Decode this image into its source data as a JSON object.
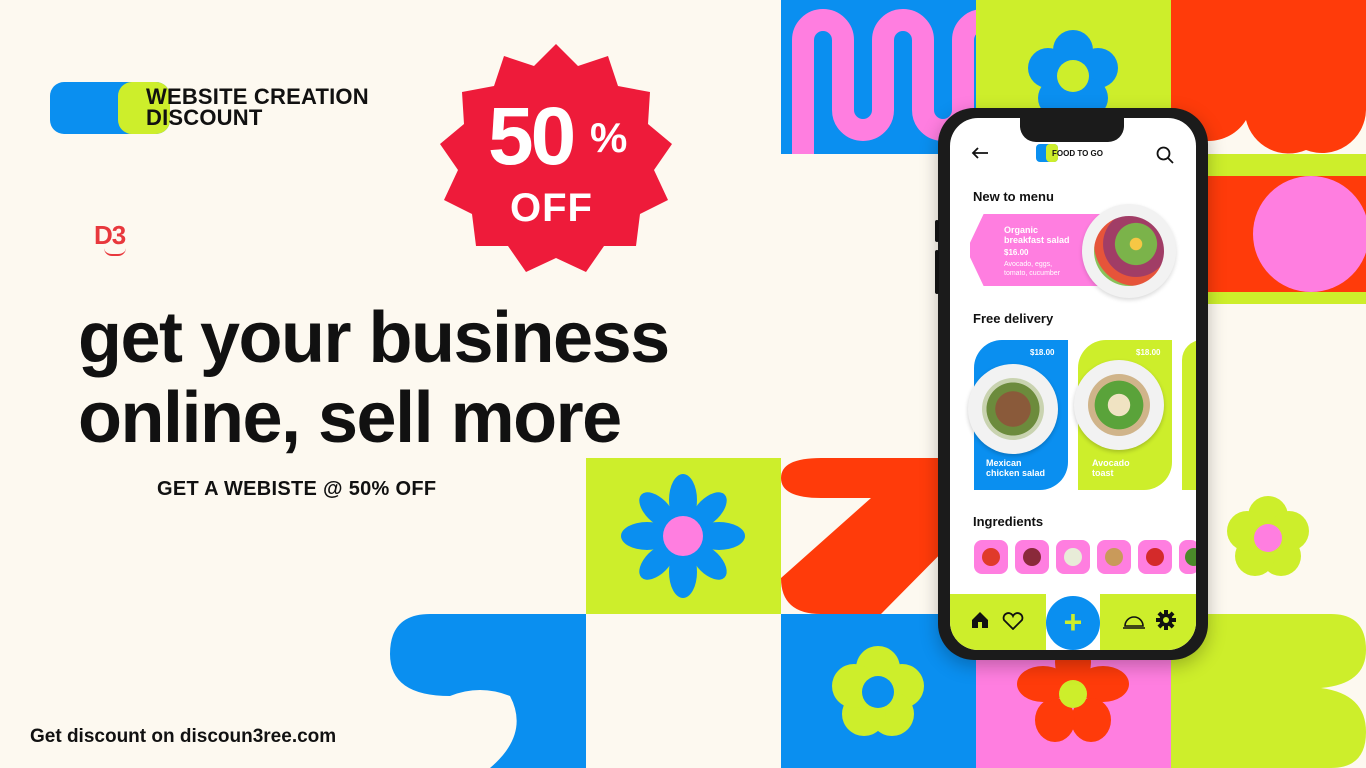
{
  "badge": {
    "text": "WEBSITE CREATION\nDISCOUNT"
  },
  "logo": {
    "text": "D3"
  },
  "headline": "get your business\nonline, sell more",
  "subhead": "GET A WEBISTE @ 50% OFF",
  "footer": "Get discount on discoun3ree.com",
  "burst": {
    "percent": "50",
    "sign": "%",
    "off": "OFF",
    "color": "#ee1b3a"
  },
  "colors": {
    "blue": "#0a8ff0",
    "lime": "#cdee2b",
    "pink": "#ff7ee0",
    "red": "#ff3b0a",
    "cream": "#fdf9f0"
  },
  "phone": {
    "back_icon": "arrow-left-icon",
    "brand": "FOOD TO GO",
    "search_icon": "search-icon",
    "new_to_menu": {
      "title": "New to menu",
      "item": {
        "name": "Organic\nbreakfast salad",
        "price": "$16.00",
        "desc": "Avocado, eggs,\ntomato, cucumber"
      }
    },
    "free_delivery": {
      "title": "Free delivery",
      "cards": [
        {
          "name": "Mexican\nchicken salad",
          "price": "$18.00"
        },
        {
          "name": "Avocado\ntoast",
          "price": "$18.00"
        }
      ]
    },
    "ingredients": {
      "title": "Ingredients",
      "items": [
        "tomato",
        "onion",
        "cucumber",
        "bread",
        "pepper",
        "broccoli"
      ]
    },
    "nav": {
      "home_icon": "home-icon",
      "heart_icon": "heart-icon",
      "add_icon": "plus-icon",
      "plus": "+",
      "cloche_icon": "cloche-icon",
      "gear_icon": "gear-icon"
    }
  }
}
